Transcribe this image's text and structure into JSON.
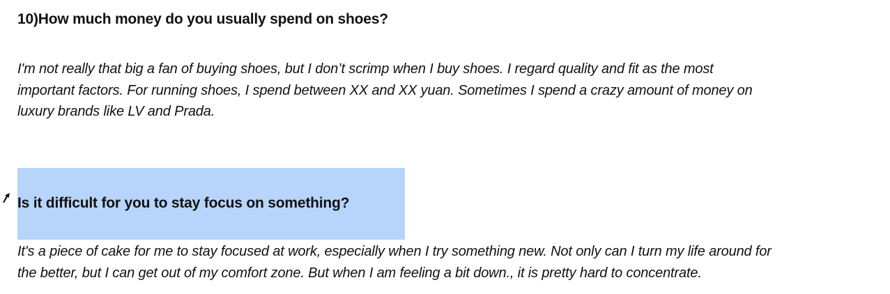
{
  "question_1": {
    "text": "10)How much money do you usually spend on shoes?"
  },
  "answer_1": {
    "lines": [
      "I'm not really that big a fan of buying shoes, but I don’t scrimp when I buy shoes. I regard quality and fit as the most",
      "important factors. For running shoes, I spend between XX and XX yuan. Sometimes I spend a crazy amount of money on",
      "luxury brands like LV and Prada."
    ]
  },
  "question_2": {
    "text": "Is it difficult for you to stay focus on something?",
    "selection_color": "#b7d5fb"
  },
  "answer_2": {
    "lines": [
      "It's a piece of cake for me to stay focused at work, especially when I try something new. Not only can I turn my life around for",
      "the better, but I can get out of my comfort zone. But when I am feeling a bit down., it is pretty hard to concentrate."
    ]
  },
  "cursor": {
    "icon": "mouse-pointer-icon"
  }
}
